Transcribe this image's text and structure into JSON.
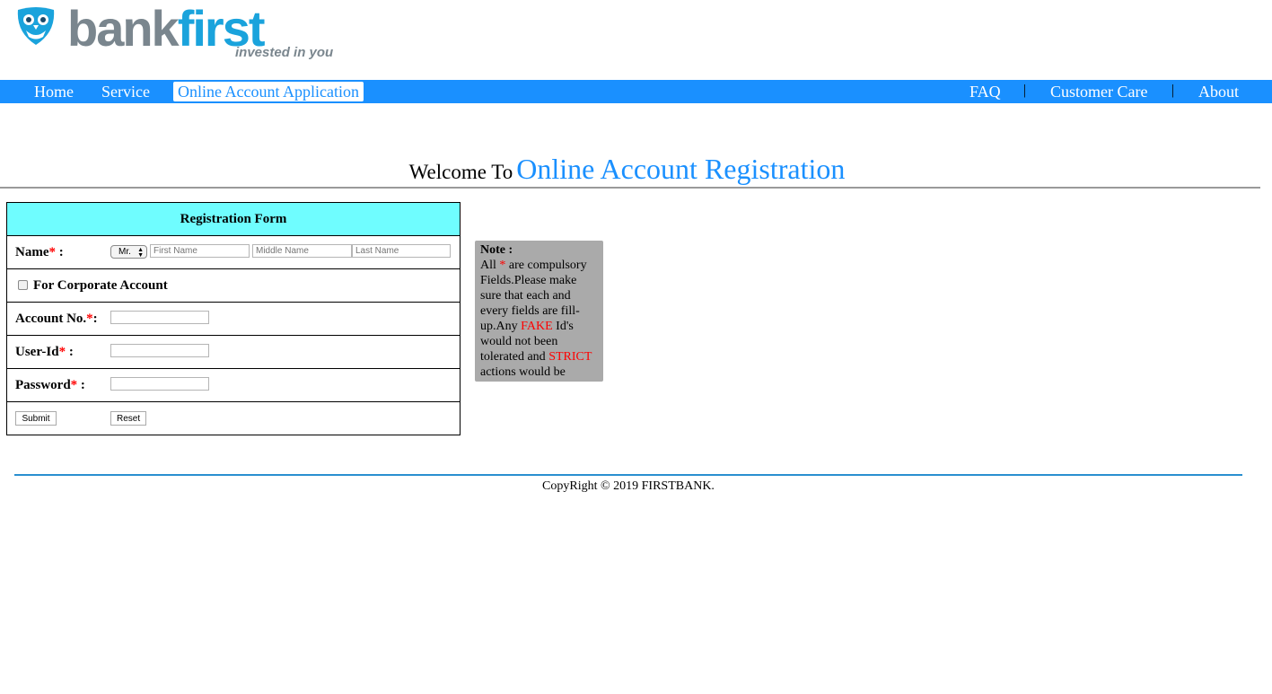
{
  "logo": {
    "wordmark_part1": "bank",
    "wordmark_part2": "first",
    "tagline": "invested in you",
    "icon": "owl-shield-icon",
    "colors": {
      "bank": "#7a868e",
      "first": "#1aa3dc"
    }
  },
  "nav": {
    "left": [
      {
        "label": "Home"
      },
      {
        "label": "Service"
      },
      {
        "label": "Online Account Application",
        "active": true
      }
    ],
    "right": [
      {
        "label": "FAQ"
      },
      {
        "label": "Customer Care"
      },
      {
        "label": "About"
      }
    ],
    "separator": "|",
    "bar_color": "#1a90ff"
  },
  "heading": {
    "prefix": "Welcome To",
    "title": "Online Account Registration"
  },
  "form": {
    "title": "Registration Form",
    "header_color": "#6ffdff",
    "required_mark": "*",
    "name": {
      "label": "Name",
      "label_suffix": " :",
      "salutation_value": "Mr.",
      "first_placeholder": "First Name",
      "middle_placeholder": "Middle Name",
      "last_placeholder": "Last Name"
    },
    "corporate": {
      "label": "For Corporate Account",
      "checked": false
    },
    "account": {
      "label": "Account No.",
      "label_suffix": ":",
      "value": ""
    },
    "userid": {
      "label": "User-Id",
      "label_suffix": " :",
      "value": ""
    },
    "password": {
      "label": "Password",
      "label_suffix": " :",
      "value": ""
    },
    "submit_label": "Submit",
    "reset_label": "Reset"
  },
  "note": {
    "title": "Note :",
    "text_1": "All ",
    "star": "*",
    "text_2": " are compulsory Fields.Please make sure that each and every fields are fill-up.Any ",
    "fake": "FAKE",
    "text_3": " Id's would not been tolerated and ",
    "strict": "STRICT",
    "text_4": " actions would be"
  },
  "footer": {
    "copyright": "CopyRight © 2019 FIRSTBANK."
  }
}
